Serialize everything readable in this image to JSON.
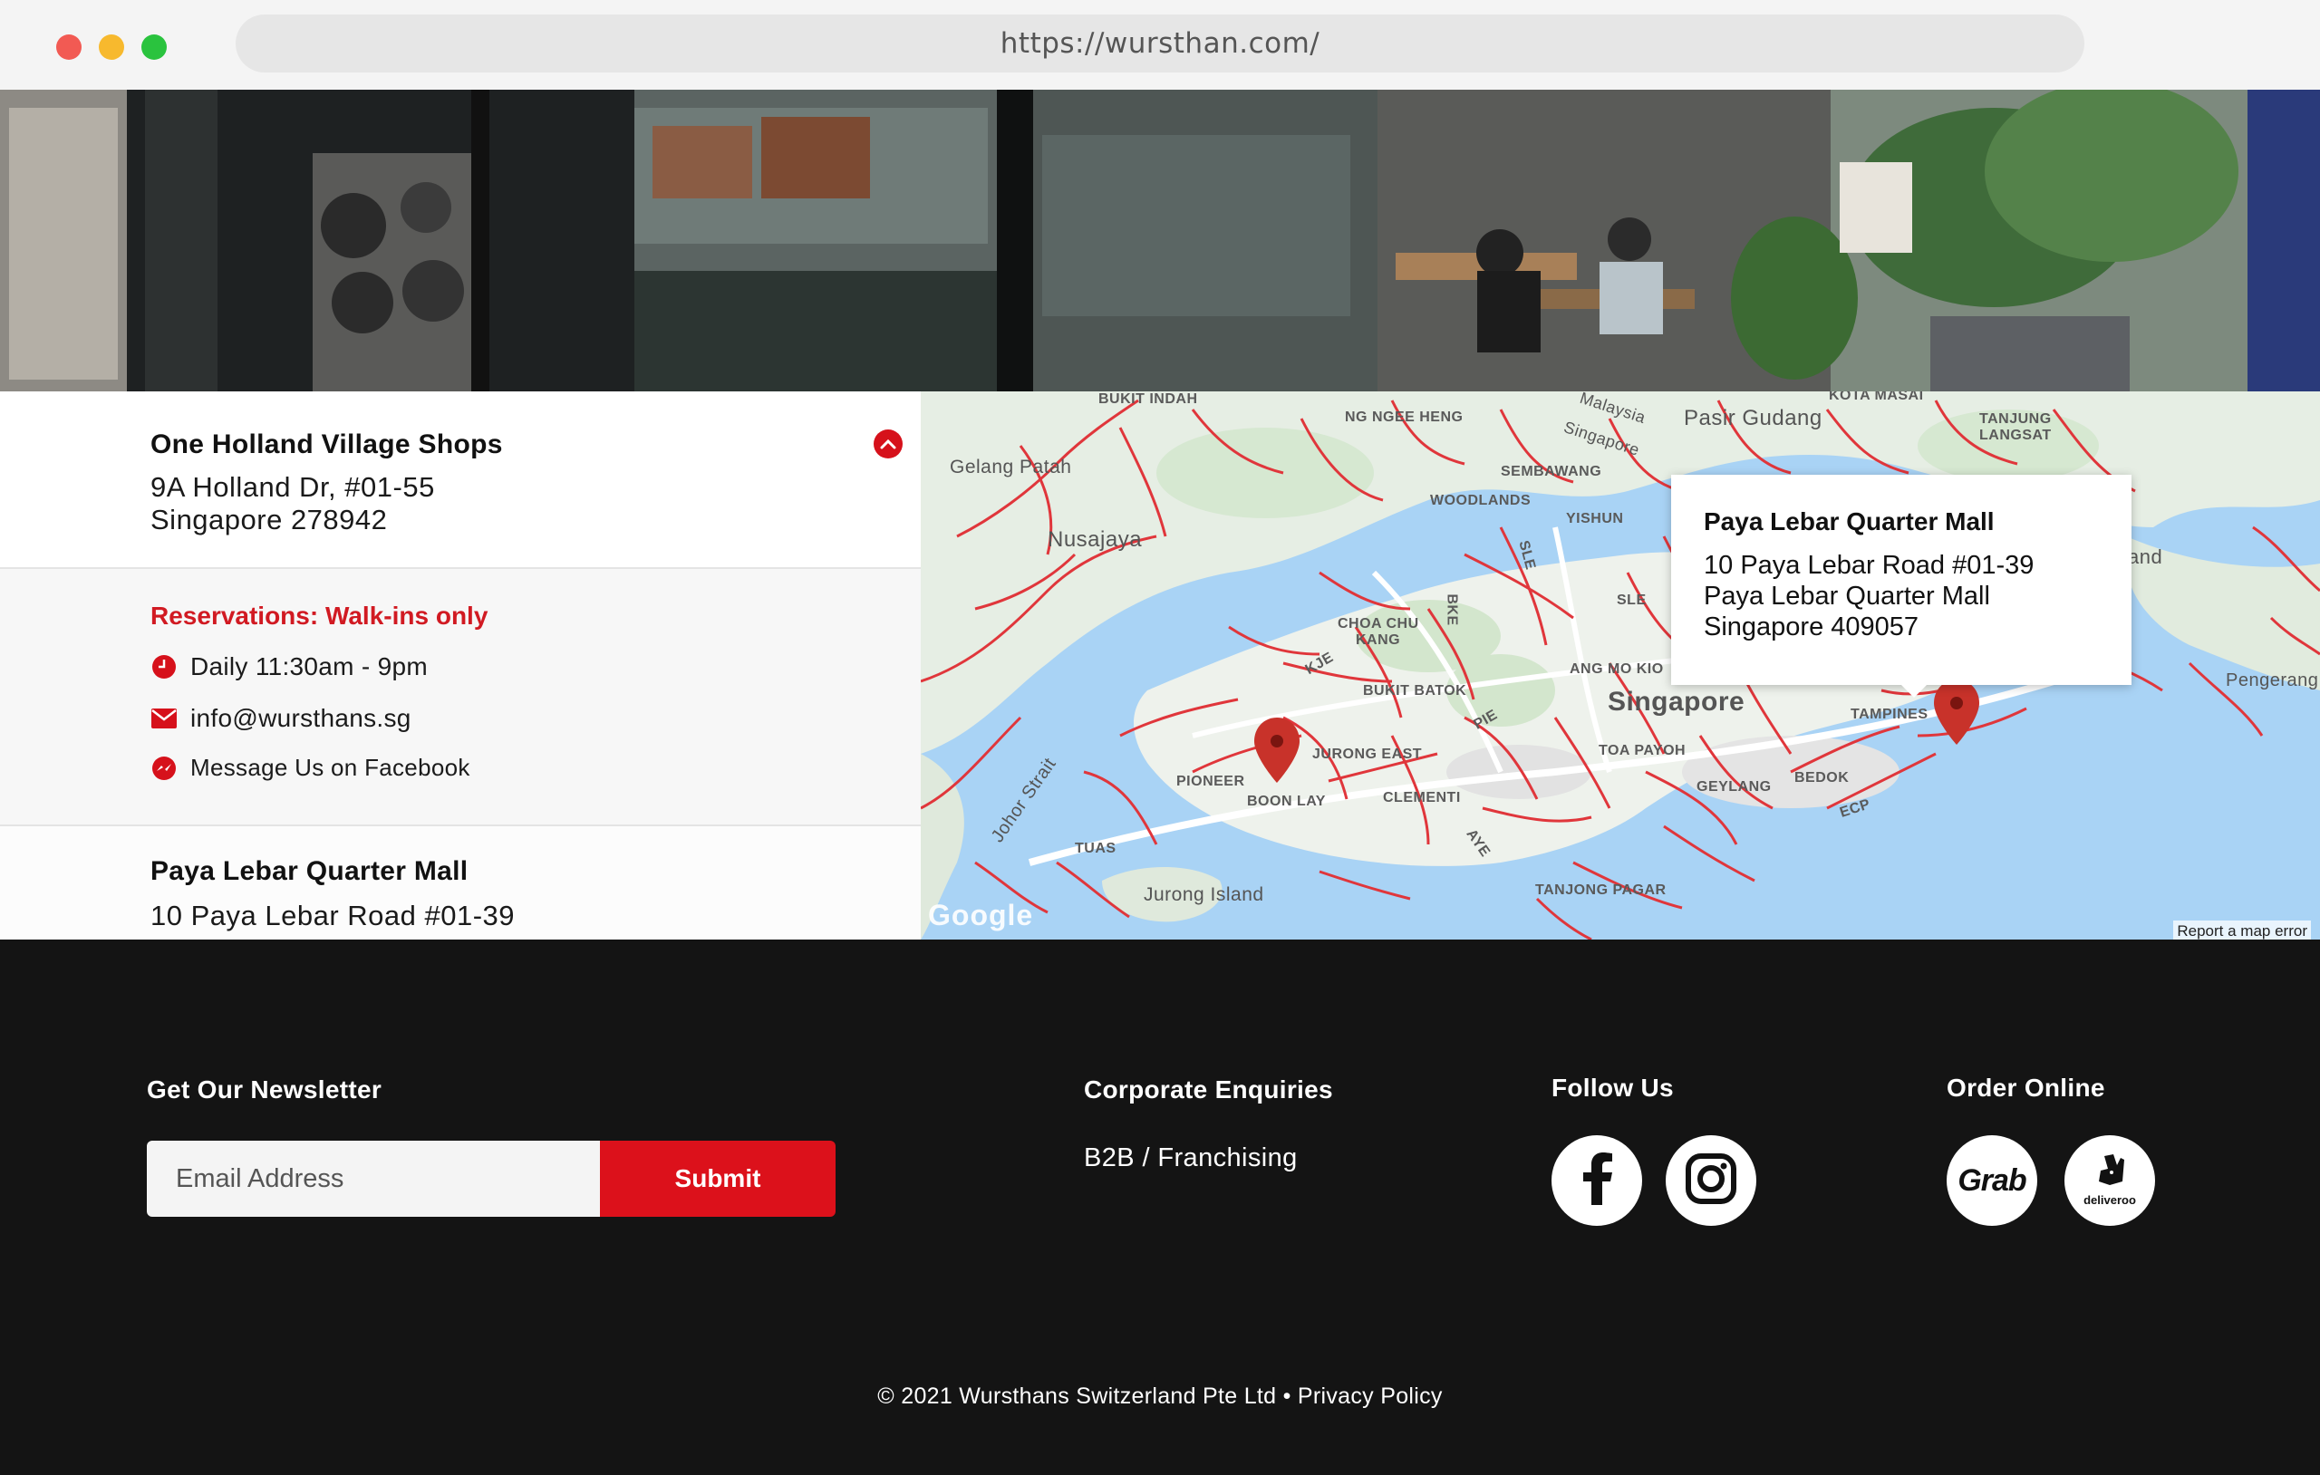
{
  "browser": {
    "url": "https://wursthan.com/"
  },
  "locations": [
    {
      "name": "One Holland Village Shops",
      "address_line1": "9A Holland Dr, #01-55",
      "address_line2": "Singapore 278942",
      "reservations": "Reservations: Walk-ins only",
      "hours": "Daily 11:30am - 9pm",
      "email": "info@wursthans.sg",
      "facebook": "Message Us on Facebook"
    },
    {
      "name": "Paya Lebar Quarter Mall",
      "address_line1": "10 Paya Lebar Road #01-39"
    }
  ],
  "map": {
    "popup": {
      "title": "Paya Lebar Quarter Mall",
      "line1": "10 Paya Lebar Road #01-39",
      "line2": "Paya Lebar Quarter Mall",
      "line3": "Singapore 409057"
    },
    "labels": {
      "bukit_indah": "BUKIT INDAH",
      "ng_ngee_heng": "NG NGEE HENG",
      "malaysia_singapore": "Malaysia",
      "singapore_border": "Singapore",
      "pasir_gudang": "Pasir Gudang",
      "kota_masai": "KOTA MASAI",
      "tanjung_langsat_1": "TANJUNG",
      "tanjung_langsat_2": "LANGSAT",
      "gelang_patah": "Gelang Patah",
      "nusajaya": "Nusajaya",
      "sembawang": "SEMBAWANG",
      "woodlands": "WOODLANDS",
      "yishun": "YISHUN",
      "sle": "SLE",
      "sle2": "SLE",
      "bke": "BKE",
      "choa_chu_kang_1": "CHOA CHU",
      "choa_chu_kang_2": "KANG",
      "kje": "KJE",
      "bukit_batok": "BUKIT BATOK",
      "pie": "PIE",
      "ang_mo_kio": "ANG MO KIO",
      "singapore": "Singapore",
      "land": "and",
      "pengerang": "Pengerang",
      "tampines": "TAMPINES",
      "jurong_east": "JURONG EAST",
      "toa_payoh": "TOA PAYOH",
      "bedok": "BEDOK",
      "pioneer": "PIONEER",
      "boon_lay": "BOON LAY",
      "clementi": "CLEMENTI",
      "geylang": "GEYLANG",
      "ecp": "ECP",
      "johor_strait": "Johor Strait",
      "tuas": "TUAS",
      "aye": "AYE",
      "jurong_island": "Jurong Island",
      "tanjong_pagar": "TANJONG PAGAR"
    },
    "brand": "Google",
    "report": "Report a map error"
  },
  "footer": {
    "newsletter_heading": "Get Our Newsletter",
    "email_placeholder": "Email Address",
    "submit_label": "Submit",
    "corporate_heading": "Corporate Enquiries",
    "corporate_link": "B2B / Franchising",
    "follow_heading": "Follow Us",
    "order_heading": "Order Online",
    "grab_label": "Grab",
    "deliveroo_label": "deliveroo",
    "copyright": "© 2021 Wursthans Switzerland Pte Ltd • Privacy Policy"
  },
  "colors": {
    "brand_red": "#d6111b",
    "footer_bg": "#141414",
    "map_water": "#a9d3f5",
    "map_land": "#e6eee4",
    "map_roads": "#e0363b"
  }
}
